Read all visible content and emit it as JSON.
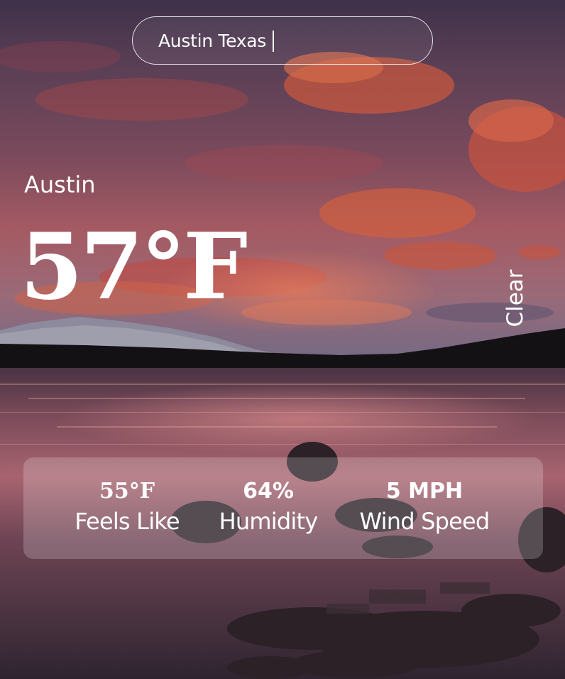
{
  "search": {
    "value": "Austin Texas",
    "placeholder": ""
  },
  "weather": {
    "city": "Austin",
    "temperature": "57°F",
    "condition": "Clear"
  },
  "stats": {
    "feels_like": {
      "value": "55°F",
      "label": "Feels Like"
    },
    "humidity": {
      "value": "64%",
      "label": "Humidity"
    },
    "wind_speed": {
      "value": "5 MPH",
      "label": "Wind Speed"
    }
  },
  "background": {
    "icon": "sunset-lake-background",
    "colors": {
      "sky_top": "#4a3a52",
      "cloud_orange": "#e0603a",
      "horizon_pink": "#b8606a",
      "mountain": "#7a7688",
      "treeline": "#151214",
      "water": "#5a3a48",
      "rocks": "#2a2026"
    }
  }
}
